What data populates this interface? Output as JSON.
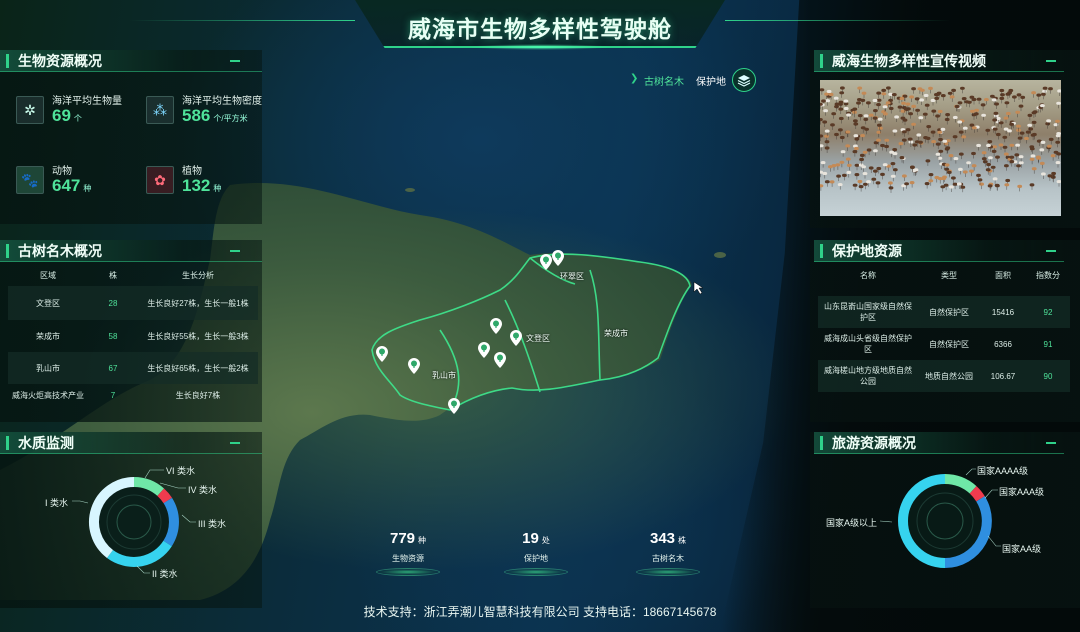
{
  "header": {
    "title": "威海市生物多样性驾驶舱"
  },
  "resources": {
    "title": "生物资源概况",
    "items": [
      {
        "label": "海洋平均生物量",
        "value": "69",
        "unit": "个",
        "icon": "molecule-icon"
      },
      {
        "label": "海洋平均生物密度",
        "value": "586",
        "unit": "个/平方米",
        "icon": "network-icon"
      },
      {
        "label": "动物",
        "value": "647",
        "unit": "种",
        "icon": "paw-icon"
      },
      {
        "label": "植物",
        "value": "132",
        "unit": "种",
        "icon": "sprout-icon"
      }
    ]
  },
  "trees": {
    "title": "古树名木概况",
    "columns": [
      "区域",
      "株",
      "生长分析"
    ],
    "rows": [
      {
        "region": "文登区",
        "count": "28",
        "analysis": "生长良好27株，生长一般1株"
      },
      {
        "region": "荣成市",
        "count": "58",
        "analysis": "生长良好55株，生长一般3株"
      },
      {
        "region": "乳山市",
        "count": "67",
        "analysis": "生长良好65株，生长一般2株"
      },
      {
        "region": "威海火炬高技术产业",
        "count": "7",
        "analysis": "生长良好7株"
      }
    ]
  },
  "water": {
    "title": "水质监测",
    "labels": [
      "VI 类水",
      "IV 类水",
      "III 类水",
      "II 类水",
      "I 类水"
    ]
  },
  "map": {
    "toggle": {
      "trees": "古树名木",
      "protected": "保护地"
    },
    "labels": [
      "环翠区",
      "文登区",
      "荣成市",
      "乳山市"
    ]
  },
  "video": {
    "title": "威海生物多样性宣传视频"
  },
  "protected": {
    "title": "保护地资源",
    "columns": [
      "名称",
      "类型",
      "面积",
      "指数分"
    ],
    "rows": [
      {
        "name": "山东昆嵛山国家级自然保护区",
        "type": "自然保护区",
        "area": "15416",
        "score": "92"
      },
      {
        "name": "威海成山头省级自然保护区",
        "type": "自然保护区",
        "area": "6366",
        "score": "91"
      },
      {
        "name": "威海槎山地方级地质自然公园",
        "type": "地质自然公园",
        "area": "106.67",
        "score": "90"
      }
    ]
  },
  "tourism": {
    "title": "旅游资源概况",
    "labels": [
      "国家AAAA级",
      "国家AAA级",
      "国家A级以上",
      "国家AA级"
    ]
  },
  "bottom": [
    {
      "value": "779",
      "unit": "种",
      "label": "生物资源"
    },
    {
      "value": "19",
      "unit": "处",
      "label": "保护地"
    },
    {
      "value": "343",
      "unit": "株",
      "label": "古树名木"
    }
  ],
  "footer": {
    "text": "技术支持：浙江弄潮儿智慧科技有限公司 支持电话：18667145678"
  },
  "colors": {
    "accent": "#2fd28a",
    "value": "#4fe39a"
  }
}
